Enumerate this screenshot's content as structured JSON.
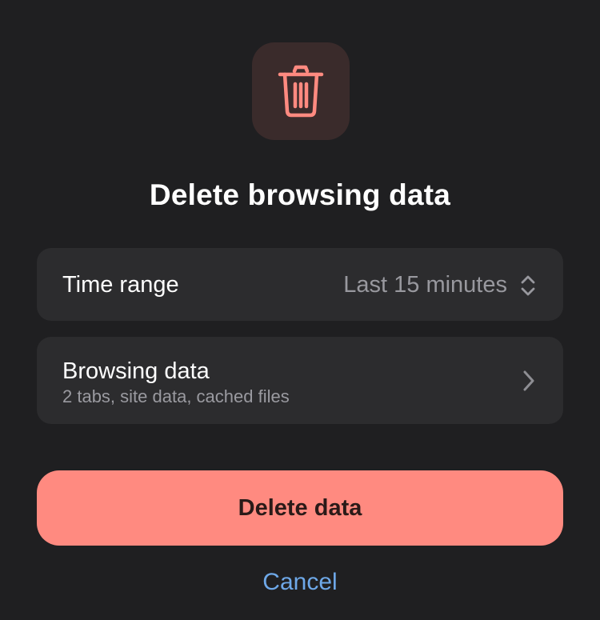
{
  "dialog": {
    "icon": "trash-icon",
    "title": "Delete browsing data"
  },
  "time_range": {
    "label": "Time range",
    "value": "Last 15 minutes",
    "icon": "up-down-chevron-icon"
  },
  "browsing_data": {
    "label": "Browsing data",
    "detail": "2 tabs, site data, cached files",
    "icon": "chevron-right-icon"
  },
  "actions": {
    "delete_label": "Delete data",
    "cancel_label": "Cancel"
  },
  "colors": {
    "background": "#1f1f21",
    "row_background": "#2c2c2e",
    "danger": "#ff8a80",
    "link": "#6ea8e8",
    "icon_tile": "#3a2b2b"
  }
}
